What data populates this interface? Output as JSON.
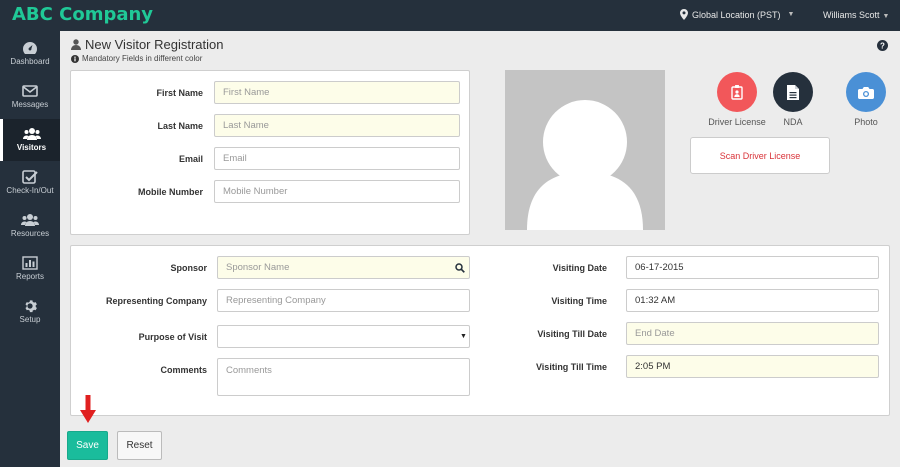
{
  "app": {
    "brand": "ABC Company",
    "location": "Global Location (PST)",
    "user": "Williams Scott"
  },
  "colors": {
    "brand": "#20c997",
    "sidebar": "#25303c",
    "driver_license": "#f2575a",
    "nda": "#25303c",
    "photo": "#4a90d6",
    "scan_text": "#d9343a",
    "save": "#1abc9c",
    "arrow": "#e02020"
  },
  "sidebar": {
    "items": [
      {
        "label": "Dashboard",
        "icon": "dashboard-icon"
      },
      {
        "label": "Messages",
        "icon": "envelope-icon"
      },
      {
        "label": "Visitors",
        "icon": "users-icon",
        "active": true
      },
      {
        "label": "Check-In/Out",
        "icon": "check-square-icon"
      },
      {
        "label": "Resources",
        "icon": "users-group-icon"
      },
      {
        "label": "Reports",
        "icon": "bar-chart-icon"
      },
      {
        "label": "Setup",
        "icon": "gear-icon"
      }
    ]
  },
  "page": {
    "title": "New Visitor Registration",
    "subtitle": "Mandatory Fields in different color"
  },
  "visitor": {
    "first_name": {
      "label": "First Name",
      "placeholder": "First Name",
      "value": ""
    },
    "last_name": {
      "label": "Last Name",
      "placeholder": "Last Name",
      "value": ""
    },
    "email": {
      "label": "Email",
      "placeholder": "Email",
      "value": ""
    },
    "mobile": {
      "label": "Mobile Number",
      "placeholder": "Mobile Number",
      "value": ""
    }
  },
  "capture": {
    "driver_license": "Driver License",
    "nda": "NDA",
    "photo": "Photo",
    "scan": "Scan Driver License"
  },
  "visit": {
    "sponsor": {
      "label": "Sponsor",
      "placeholder": "Sponsor Name",
      "value": ""
    },
    "company": {
      "label": "Representing Company",
      "placeholder": "Representing Company",
      "value": ""
    },
    "purpose": {
      "label": "Purpose of Visit",
      "value": ""
    },
    "comments": {
      "label": "Comments",
      "placeholder": "Comments",
      "value": ""
    },
    "date": {
      "label": "Visiting Date",
      "value": "06-17-2015"
    },
    "time": {
      "label": "Visiting Time",
      "value": "01:32 AM"
    },
    "till_date": {
      "label": "Visiting Till Date",
      "placeholder": "End Date",
      "value": ""
    },
    "till_time": {
      "label": "Visiting Till Time",
      "value": "2:05 PM"
    }
  },
  "actions": {
    "save": "Save",
    "reset": "Reset"
  }
}
